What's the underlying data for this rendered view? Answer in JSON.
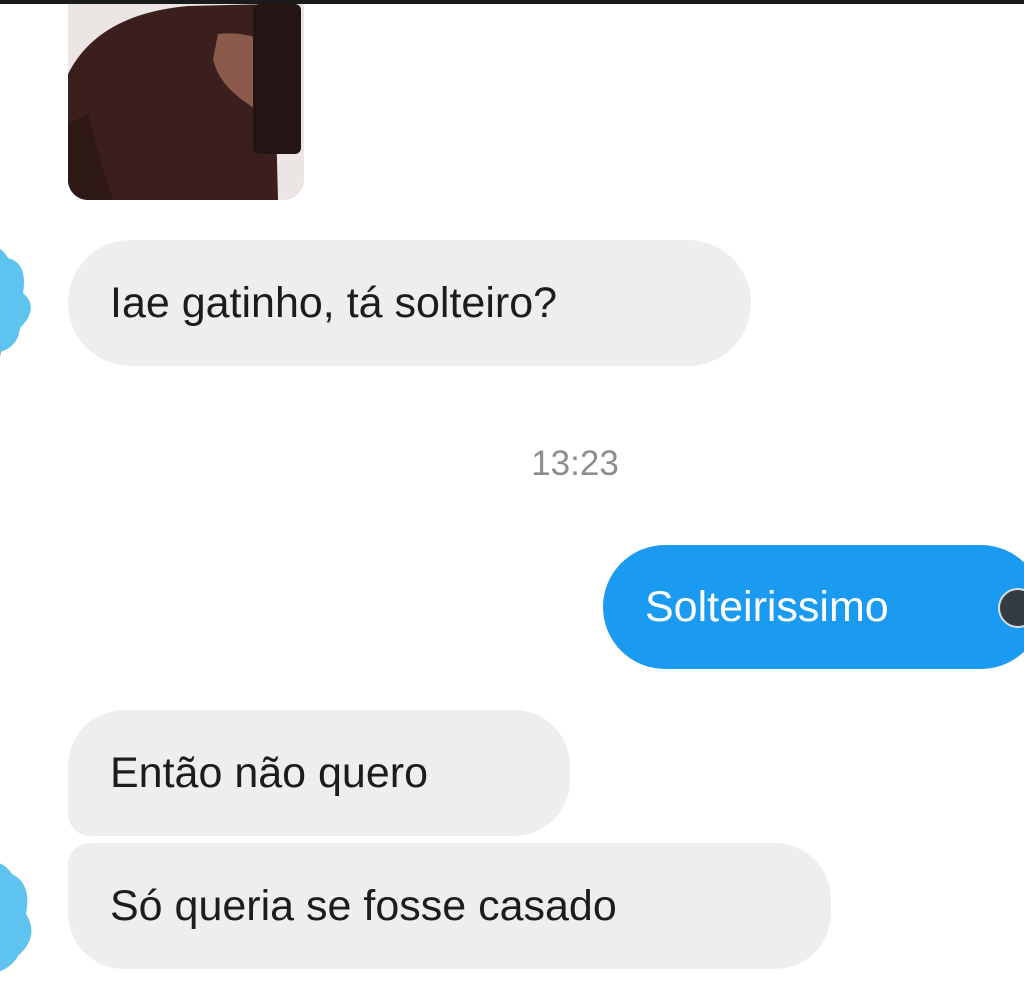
{
  "messages": [
    {
      "id": "msg1",
      "direction": "incoming",
      "text": "Iae gatinho, tá solteiro?"
    },
    {
      "id": "msg2",
      "direction": "outgoing",
      "text": "Solteirissimo"
    },
    {
      "id": "msg3",
      "direction": "incoming",
      "text": "Então não quero"
    },
    {
      "id": "msg4",
      "direction": "incoming",
      "text": "Só queria se fosse casado"
    }
  ],
  "timestamp": "13:23",
  "colors": {
    "incoming_bubble": "#eeeeee",
    "outgoing_bubble": "#1a9af1",
    "incoming_text": "#1c1c1c",
    "outgoing_text": "#ffffff",
    "timestamp_text": "#8e8e8e",
    "avatar": "#5fc3f0"
  },
  "icons": {
    "avatar": "contact-avatar-icon",
    "emoji": "emoji-icon",
    "photo": "shared-photo"
  }
}
